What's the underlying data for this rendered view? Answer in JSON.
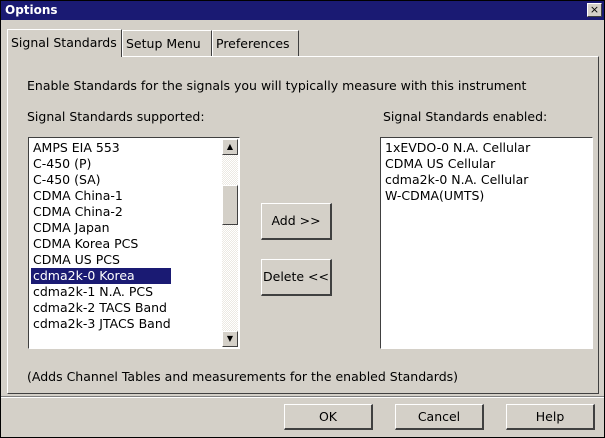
{
  "window": {
    "title": "Options",
    "close_glyph": "×"
  },
  "tabs": [
    {
      "label": "Signal Standards",
      "active": true
    },
    {
      "label": "Setup Menu",
      "active": false
    },
    {
      "label": "Preferences",
      "active": false
    }
  ],
  "page": {
    "intro": "Enable Standards for the signals you will typically measure with this instrument",
    "supported_label": "Signal Standards supported:",
    "enabled_label": "Signal Standards enabled:",
    "footnote": "(Adds Channel Tables and measurements for the enabled Standards)"
  },
  "supported_list": {
    "items": [
      "AMPS EIA 553",
      "C-450 (P)",
      "C-450 (SA)",
      "CDMA China-1",
      "CDMA China-2",
      "CDMA Japan",
      "CDMA Korea PCS",
      "CDMA US PCS",
      "cdma2k-0 Korea",
      "cdma2k-1 N.A. PCS",
      "cdma2k-2 TACS Band",
      "cdma2k-3 JTACS Band"
    ],
    "selected_index": 8
  },
  "enabled_list": {
    "items": [
      "1xEVDO-0 N.A. Cellular",
      "CDMA US Cellular",
      "cdma2k-0 N.A. Cellular",
      "W-CDMA(UMTS)"
    ]
  },
  "buttons": {
    "add": "Add >>",
    "delete": "Delete <<",
    "ok": "OK",
    "cancel": "Cancel",
    "help": "Help"
  },
  "icons": {
    "scroll_up": "▲",
    "scroll_down": "▼"
  },
  "colors": {
    "titlebar": "#1a1a73",
    "selection": "#1a1a73",
    "face": "#d4d0c8"
  }
}
